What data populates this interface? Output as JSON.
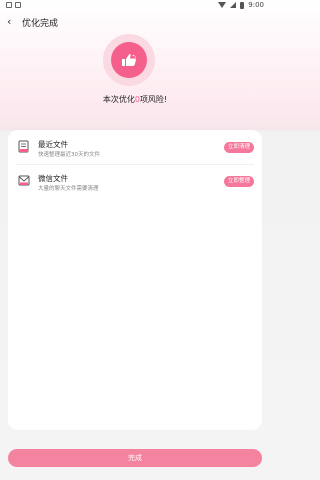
{
  "status_bar": {
    "time": "9:00"
  },
  "nav": {
    "back_glyph": "‹",
    "title": "优化完成"
  },
  "hero": {
    "prefix": "本次优化",
    "count": "0",
    "suffix": "项风险!"
  },
  "items": [
    {
      "title": "最近文件",
      "subtitle": "快速整理最近30天的文件",
      "button": "立即清理",
      "icon": "document-icon"
    },
    {
      "title": "微信文件",
      "subtitle": "大量的聊天文件需要清理",
      "button": "立即整理",
      "icon": "envelope-icon"
    }
  ],
  "footer": {
    "done_label": "完成"
  },
  "colors": {
    "accent": "#f55f8b",
    "accent_light": "#fbd9e3",
    "button": "#f5779a"
  }
}
